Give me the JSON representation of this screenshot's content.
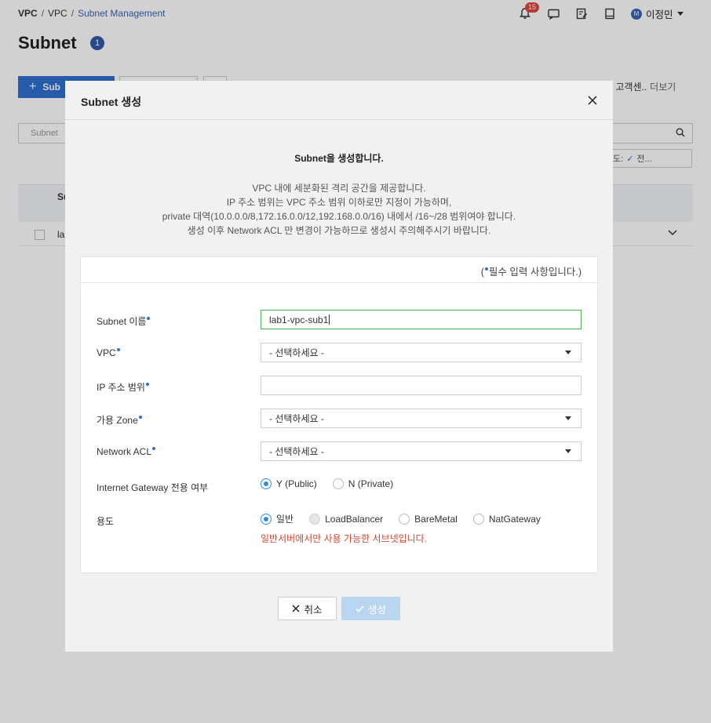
{
  "breadcrumb": {
    "items": [
      "VPC",
      "VPC",
      "Subnet Management"
    ],
    "sep": "/"
  },
  "header": {
    "notification_count": "15",
    "user_initial": "M",
    "user_name": "이정민"
  },
  "page": {
    "title": "Subnet",
    "count": "1"
  },
  "bg": {
    "create_label": "Sub",
    "helper_label": "필 고객센..",
    "helper_more": "더보기",
    "search_placeholder": "Subnet",
    "filter_label": "도:",
    "filter_value": "전...",
    "table_head": "Su",
    "row_text": "la"
  },
  "modal": {
    "title": "Subnet 생성",
    "intro_head": "Subnet을 생성합니다.",
    "intro_lines": [
      "VPC 내에 세분화된 격리 공간을 제공합니다.",
      "IP 주소 범위는 VPC 주소 범위 이하로만 지정이 가능하며,",
      "private 대역(10.0.0.0/8,172.16.0.0/12,192.168.0.0/16) 내에서 /16~/28 범위여야 합니다.",
      "생성 이후 Network ACL 만 변경이 가능하므로 생성시 주의해주시기 바랍니다."
    ],
    "required_note_prefix": "(",
    "required_note": "필수 입력 사항입니다.)",
    "fields": {
      "subnet_name": {
        "label": "Subnet 이름",
        "value": "lab1-vpc-sub1"
      },
      "vpc": {
        "label": "VPC",
        "value": "- 선택하세요 -"
      },
      "ip_range": {
        "label": "IP 주소 범위",
        "value": ""
      },
      "zone": {
        "label": "가용 Zone",
        "value": "- 선택하세요 -"
      },
      "acl": {
        "label": "Network ACL",
        "value": "- 선택하세요 -"
      },
      "igw": {
        "label": "Internet Gateway 전용 여부",
        "options": [
          "Y (Public)",
          "N (Private)"
        ],
        "selected": "Y (Public)"
      },
      "usage": {
        "label": "용도",
        "options": [
          "일반",
          "LoadBalancer",
          "BareMetal",
          "NatGateway"
        ],
        "selected": "일반",
        "warning": "일반서버에서만 사용 가능한 서브넷입니다."
      }
    },
    "cancel_label": "취소",
    "create_label": "생성"
  },
  "colors": {
    "primary": "#2f6fd0",
    "accent": "#2f8be0",
    "warning": "#d9452f",
    "active_border": "#4cae4c",
    "disabled_button": "#b8d6f0"
  }
}
